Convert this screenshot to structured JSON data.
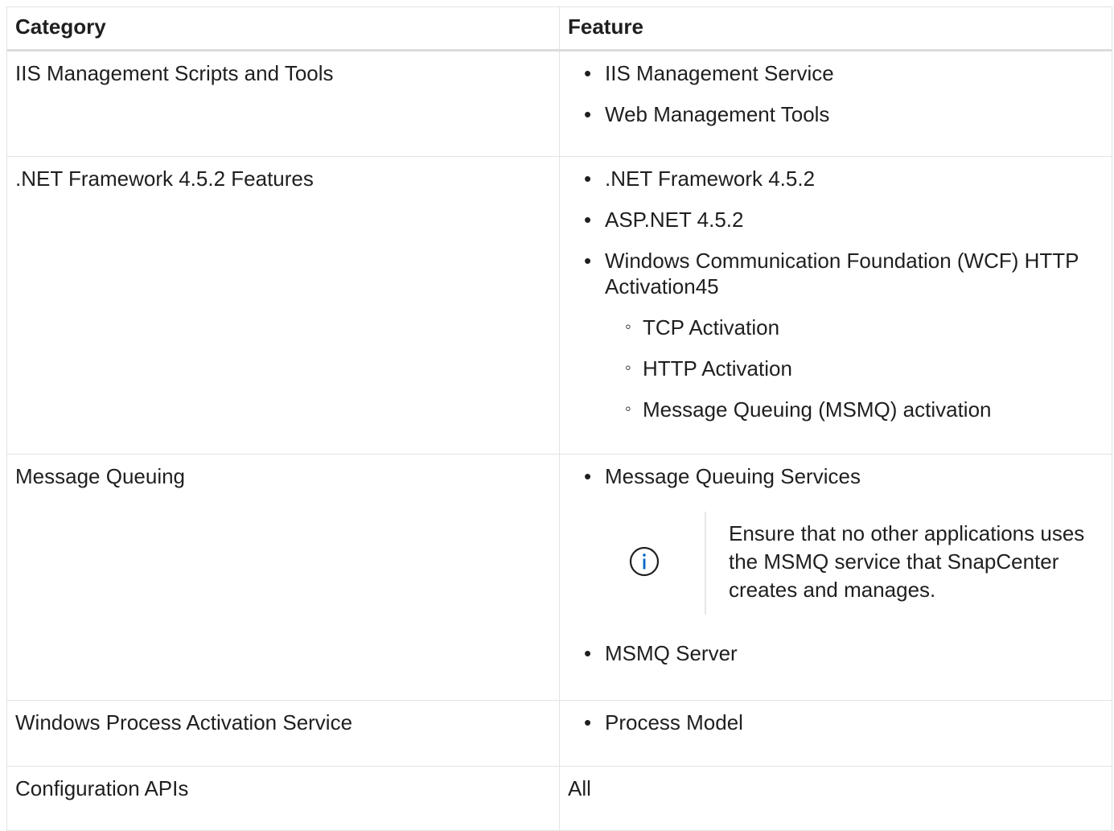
{
  "table": {
    "headers": [
      "Category",
      "Feature"
    ],
    "rows": [
      {
        "category": "IIS Management Scripts and Tools",
        "features": [
          "IIS Management Service",
          "Web Management Tools"
        ]
      },
      {
        "category": ".NET Framework 4.5.2 Features",
        "features": [
          ".NET Framework 4.5.2",
          "ASP.NET 4.5.2",
          "Windows Communication Foundation (WCF) HTTP Activation45"
        ],
        "subfeatures": [
          "TCP Activation",
          "HTTP Activation",
          "Message Queuing (MSMQ) activation"
        ]
      },
      {
        "category": "Message Queuing",
        "features": [
          "Message Queuing Services",
          "MSMQ Server"
        ],
        "note": "Ensure that no other applications uses the MSMQ service that SnapCenter creates and manages.",
        "note_icon": "info-icon"
      },
      {
        "category": "Windows Process Activation Service",
        "features": [
          "Process Model"
        ]
      },
      {
        "category": "Configuration APIs",
        "feature_text": "All"
      }
    ]
  },
  "colors": {
    "border": "#e3e3e3",
    "icon": "#0067c5",
    "text": "#1f1f1f"
  }
}
